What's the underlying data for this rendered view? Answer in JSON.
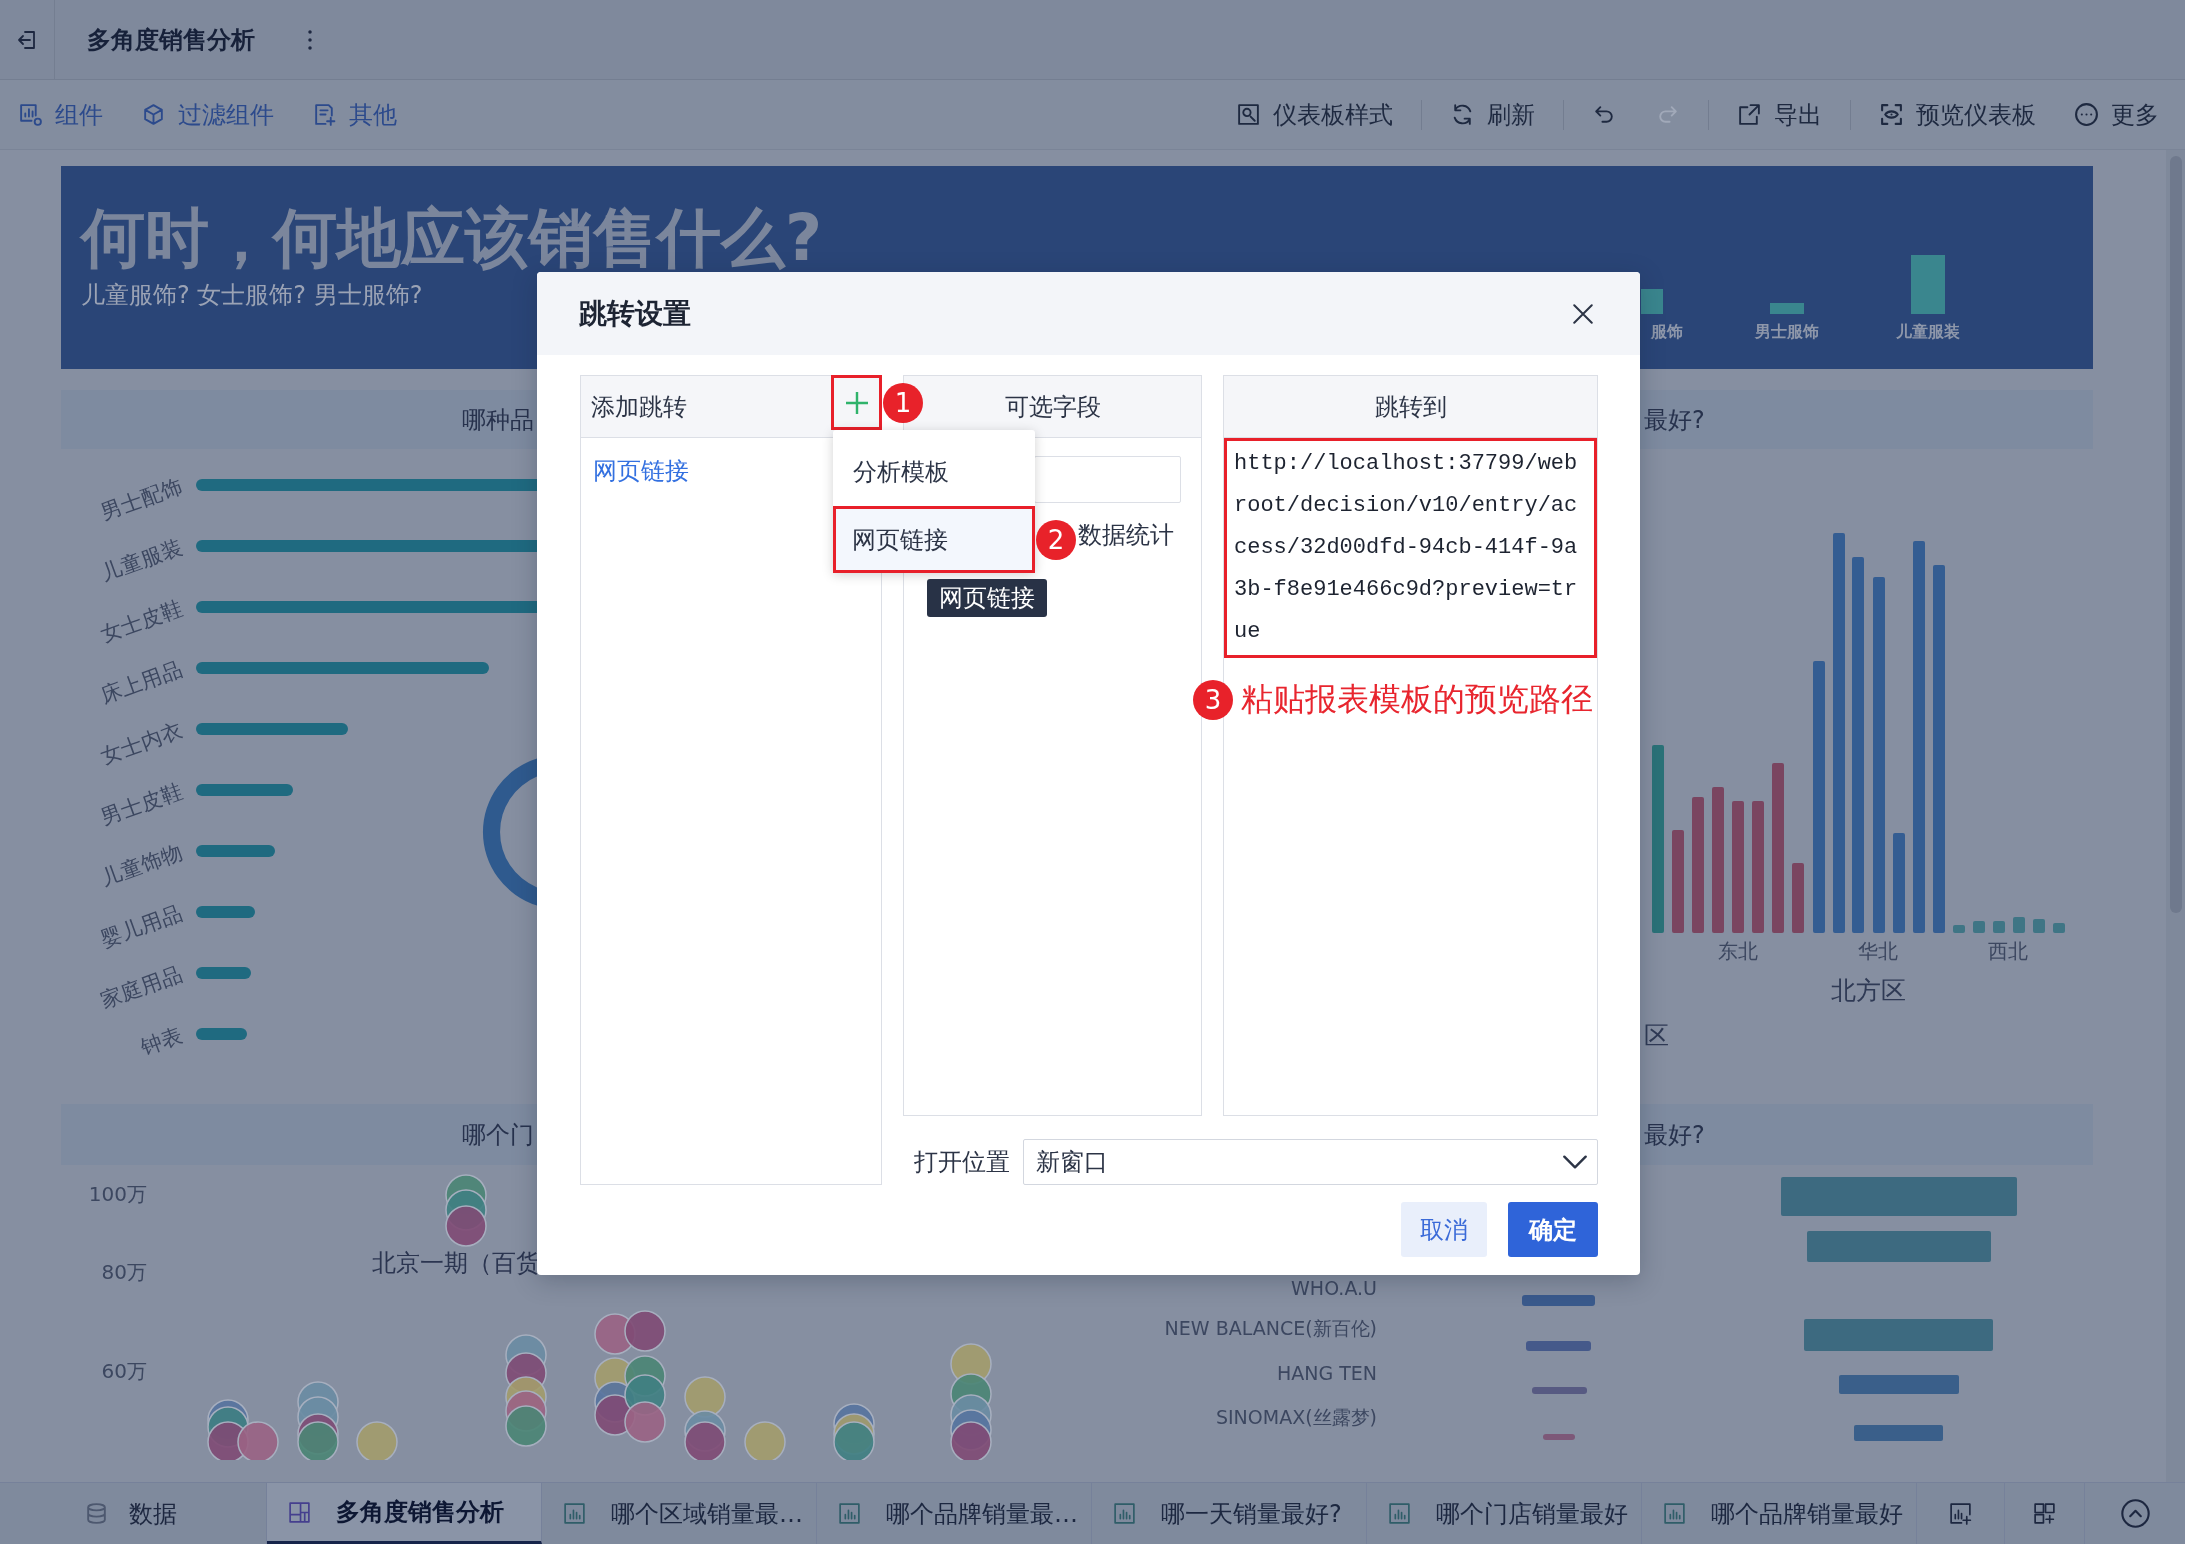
{
  "top_bar": {
    "title": "多角度销售分析"
  },
  "toolbar": {
    "left": [
      {
        "label": "组件"
      },
      {
        "label": "过滤组件"
      },
      {
        "label": "其他"
      }
    ],
    "right": [
      {
        "items": [
          {
            "kind": "text",
            "label": "仪表板样式",
            "disabled": false
          }
        ]
      },
      {
        "items": [
          {
            "kind": "text",
            "label": "刷新",
            "disabled": false
          }
        ]
      },
      {
        "items": [
          {
            "kind": "icon",
            "disabled": false
          },
          {
            "kind": "icon",
            "disabled": true
          }
        ]
      },
      {
        "items": [
          {
            "kind": "text",
            "label": "导出",
            "disabled": false
          }
        ]
      },
      {
        "items": [
          {
            "kind": "text",
            "label": "预览仪表板",
            "disabled": false
          },
          {
            "kind": "text",
            "label": "更多",
            "disabled": false
          }
        ]
      }
    ]
  },
  "dashboard": {
    "banner": {
      "title": "何时，何地应该销售什么?",
      "subtitle": "儿童服饰? 女士服饰? 男士服饰?",
      "chart_labels": [
        "服饰",
        "男士服饰",
        "儿童服装"
      ]
    },
    "category_panel": {
      "heading": "哪种品",
      "categories": [
        "男士配饰",
        "儿童服装",
        "女士皮鞋",
        "床上用品",
        "女士内衣",
        "男士皮鞋",
        "儿童饰物",
        "婴儿用品",
        "家庭用品",
        "钟表"
      ]
    },
    "region_panel": {
      "heading": "最好?",
      "region_labels": [
        "东北",
        "华北",
        "西北"
      ],
      "group_labels": [
        "北方区",
        "区"
      ]
    },
    "store_panel": {
      "heading": "哪个门",
      "y_labels": [
        "100万",
        "80万",
        "60万"
      ],
      "point_label": "北京一期（百货"
    },
    "brand_panel": {
      "heading": "最好?",
      "brands": [
        "WHO.A.U",
        "NEW BALANCE(新百伦)",
        "HANG TEN",
        "SINOMAX(丝露梦)"
      ]
    }
  },
  "dialog": {
    "title": "跳转设置",
    "jump_list": {
      "heading": "添加跳转",
      "add_button": {
        "callout": "1"
      },
      "items": [
        {
          "label": "网页链接",
          "selected": true
        }
      ]
    },
    "add_menu": {
      "items": [
        {
          "label": "分析模板",
          "selected": false
        },
        {
          "label": "网页链接",
          "selected": true,
          "callout": "2"
        }
      ]
    },
    "tooltip": {
      "text": "网页链接"
    },
    "fields_panel": {
      "heading": "可选字段",
      "items": [
        {
          "label": "数据统计"
        }
      ]
    },
    "target_panel": {
      "heading": "跳转到",
      "url": "http://localhost:37799/webroot/decision/v10/entry/access/32d00dfd-94cb-414f-9a3b-f8e91e466c9d?preview=true",
      "callout": "3",
      "note": "粘贴报表模板的预览路径"
    },
    "open_location": {
      "label": "打开位置",
      "value": "新窗口"
    },
    "buttons": [
      {
        "kind": "secondary",
        "label": "取消"
      },
      {
        "kind": "primary",
        "label": "确定"
      }
    ]
  },
  "bottom_tabs": {
    "data_button": {
      "label": "数据"
    },
    "tabs": [
      {
        "kind": "dashboard",
        "label": "多角度销售分析",
        "selected": true
      },
      {
        "kind": "component",
        "label": "哪个区域销量最…",
        "selected": false
      },
      {
        "kind": "component",
        "label": "哪个品牌销量最…",
        "selected": false
      },
      {
        "kind": "component",
        "label": "哪一天销量最好?",
        "selected": false
      },
      {
        "kind": "component",
        "label": "哪个门店销量最好",
        "selected": false
      },
      {
        "kind": "component",
        "label": "哪个品牌销量最好",
        "selected": false
      }
    ]
  }
}
